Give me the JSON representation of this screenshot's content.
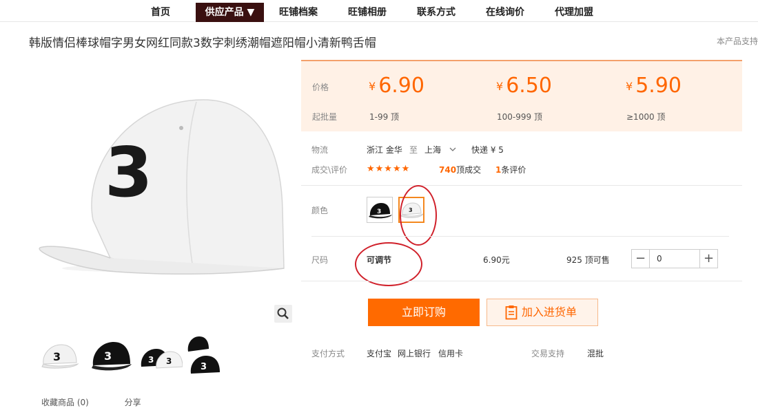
{
  "nav": {
    "items": [
      {
        "label": "首页"
      },
      {
        "label": "供应产品 ▼"
      },
      {
        "label": "旺铺档案"
      },
      {
        "label": "旺铺相册"
      },
      {
        "label": "联系方式"
      },
      {
        "label": "在线询价"
      },
      {
        "label": "代理加盟"
      }
    ]
  },
  "product": {
    "title": "韩版情侣棒球帽字男女网红同款3数字刺绣潮帽遮阳帽小清新鸭舌帽",
    "support_note": "本产品支持"
  },
  "pricing": {
    "price_label": "价格",
    "batch_label": "起批量",
    "currency": "¥",
    "tiers": [
      {
        "price": "6.90",
        "range": "1-99 顶"
      },
      {
        "price": "6.50",
        "range": "100-999 顶"
      },
      {
        "price": "5.90",
        "range": "≥1000 顶"
      }
    ]
  },
  "logistics": {
    "label": "物流",
    "from": "浙江 金华",
    "to_word": "至",
    "to": "上海",
    "shipping": "快递 ¥ 5"
  },
  "deals": {
    "label": "成交\\评价",
    "stars": "★★★★★",
    "count": "740",
    "count_suffix": "顶成交",
    "reviews": "1",
    "reviews_suffix": "条评价"
  },
  "color": {
    "label": "颜色",
    "options": [
      "black-cap",
      "white-cap"
    ],
    "selected": "white-cap"
  },
  "size": {
    "label": "尺码",
    "value": "可调节",
    "price": "6.90元",
    "stock": "925 顶可售",
    "quantity": "0",
    "minus": "−",
    "plus": "+"
  },
  "actions": {
    "buy": "立即订购",
    "cart": "加入进货单"
  },
  "payment": {
    "label": "支付方式",
    "methods": [
      "支付宝",
      "网上银行",
      "信用卡"
    ],
    "trade_label": "交易支持",
    "trade_value": "混批"
  },
  "bottom_links": [
    "收藏商品 (0)",
    "分享"
  ],
  "colors": {
    "accent": "#ff6600",
    "nav_active": "#3a1010",
    "annotation": "#d0202a"
  }
}
